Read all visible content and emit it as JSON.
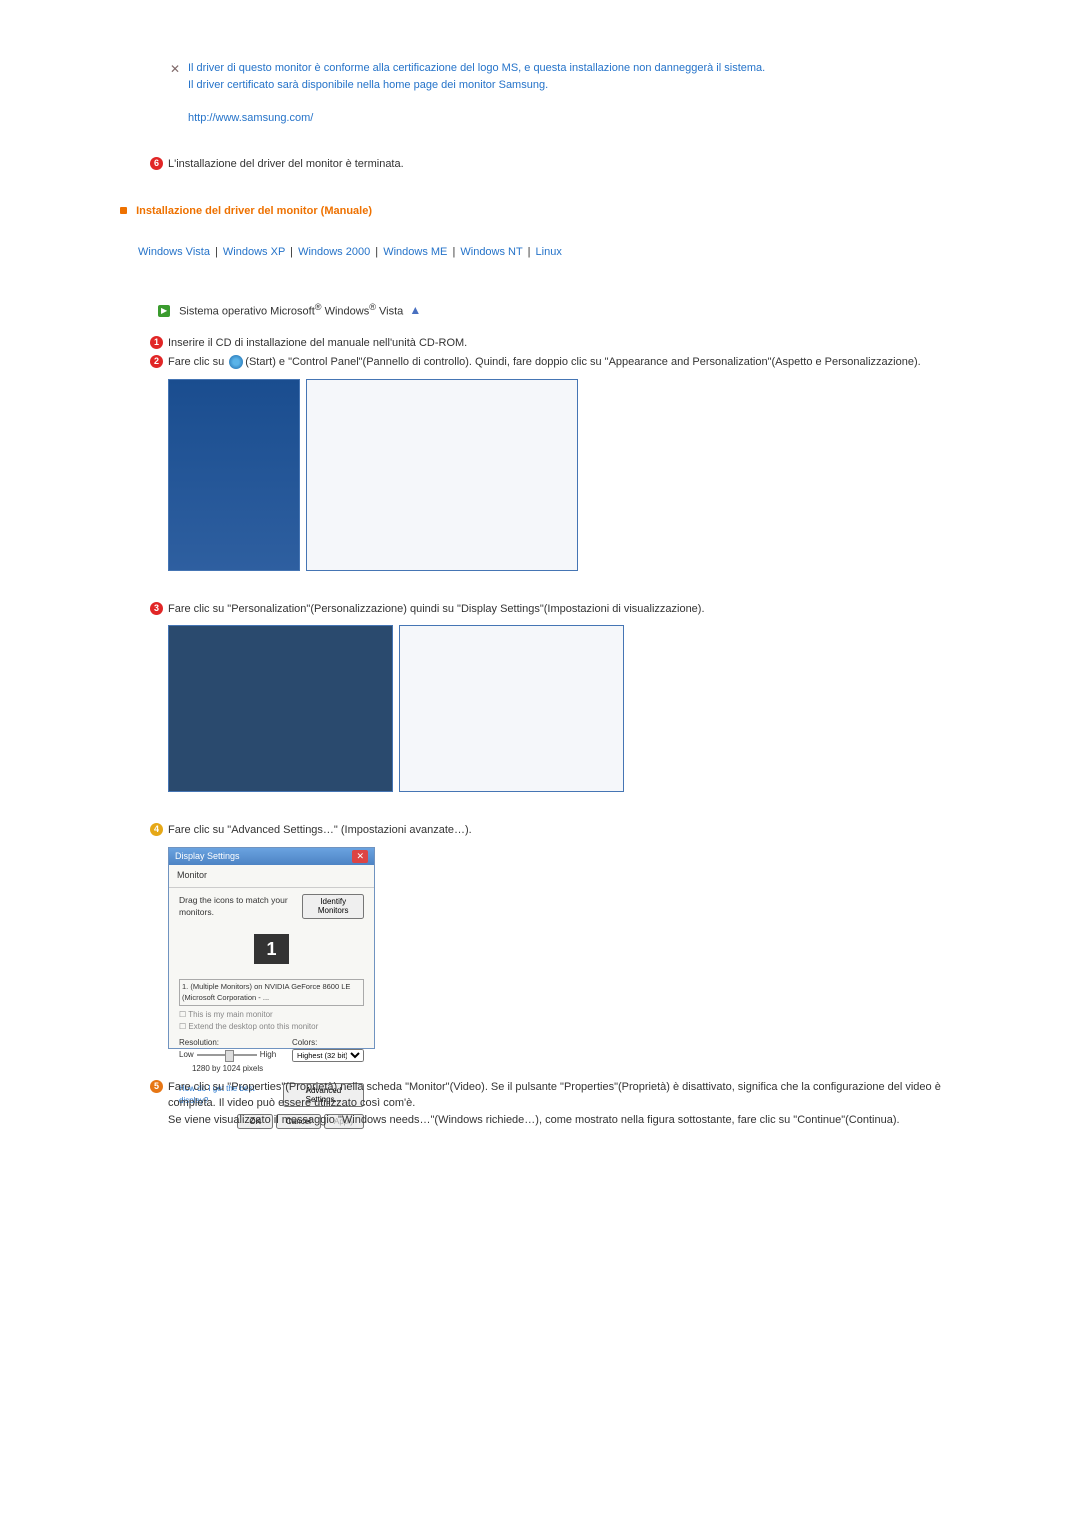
{
  "driver_note": {
    "line1": "Il driver di questo monitor è conforme alla certificazione del logo MS, e questa installazione non danneggerà il sistema.",
    "line2": "Il driver certificato sarà disponibile nella home page dei monitor Samsung.",
    "url": "http://www.samsung.com/"
  },
  "step6_text": "L'installazione del driver del monitor è terminata.",
  "manual_title": "Installazione del driver del monitor (Manuale)",
  "os_links": {
    "vista": "Windows Vista",
    "xp": "Windows XP",
    "w2000": "Windows 2000",
    "me": "Windows ME",
    "nt": "Windows NT",
    "linux": "Linux"
  },
  "vista_heading": {
    "prefix": "Sistema operativo Microsoft",
    "os1": " Windows",
    "os2": " Vista"
  },
  "vista_steps": {
    "step1": "Inserire il CD di installazione del manuale nell'unità CD-ROM.",
    "step2a": "Fare clic su ",
    "step2b": "(Start) e \"Control Panel\"(Pannello di controllo). Quindi, fare doppio clic su \"Appearance and Personalization\"(Aspetto e Personalizzazione).",
    "step3": "Fare clic su \"Personalization\"(Personalizzazione) quindi su \"Display Settings\"(Impostazioni di visualizzazione).",
    "step4": "Fare clic su \"Advanced Settings…\" (Impostazioni avanzate…).",
    "step5a": "Fare clic su \"Properties\"(Proprietà) nella scheda \"Monitor\"(Video). Se il pulsante \"Properties\"(Proprietà) è disattivato, significa che la configurazione del video è completa. Il video può essere utilizzato così com'è.",
    "step5b": "Se viene visualizzato il messaggio \"Windows needs…\"(Windows richiede…), come mostrato nella figura sottostante, fare clic su \"Continue\"(Continua)."
  },
  "display_dialog": {
    "title": "Display Settings",
    "tab": "Monitor",
    "instruction": "Drag the icons to match your monitors.",
    "identify_btn": "Identify Monitors",
    "monitor_num": "1",
    "device": "1. (Multiple Monitors) on NVIDIA GeForce 8600 LE (Microsoft Corporation - ...",
    "checkbox1": "This is my main monitor",
    "checkbox2": "Extend the desktop onto this monitor",
    "resolution_label": "Resolution:",
    "low": "Low",
    "high": "High",
    "resolution": "1280 by 1024 pixels",
    "colors_label": "Colors:",
    "colors": "Highest (32 bit)",
    "help_link": "How do I get the best display?",
    "advanced_btn": "Advanced Settings...",
    "ok": "OK",
    "cancel": "Cancel",
    "apply": "Apply"
  }
}
